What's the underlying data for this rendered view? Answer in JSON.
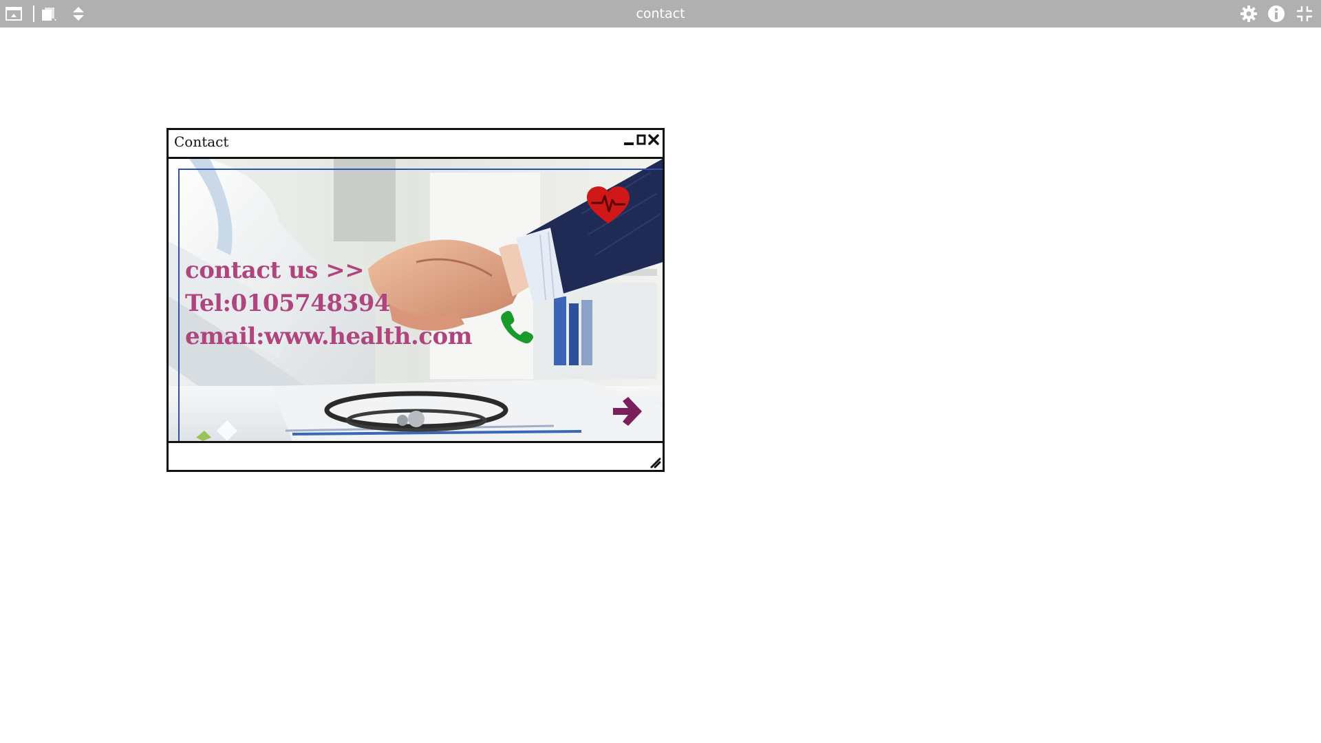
{
  "viewer": {
    "title": "contact",
    "icons": {
      "left": [
        "panel-toggle-icon",
        "pages-menu-icon",
        "page-navigate-icon"
      ],
      "right": [
        "gear-icon",
        "info-icon",
        "exit-fullscreen-icon"
      ]
    },
    "bar_color": "#b0b0b0"
  },
  "window": {
    "title": "Contact",
    "controls": [
      "minimize-icon",
      "maximize-icon",
      "close-icon"
    ]
  },
  "content": {
    "line1": "contact us >>",
    "line2": "Tel:0105748394",
    "line3": "email:www.health.com",
    "text_color": "#b0457e",
    "heart_color": "#d01818",
    "phone_color": "#1a9a2a",
    "arrow_color": "#7a1f5a",
    "frame_color": "#2e4fb0"
  }
}
